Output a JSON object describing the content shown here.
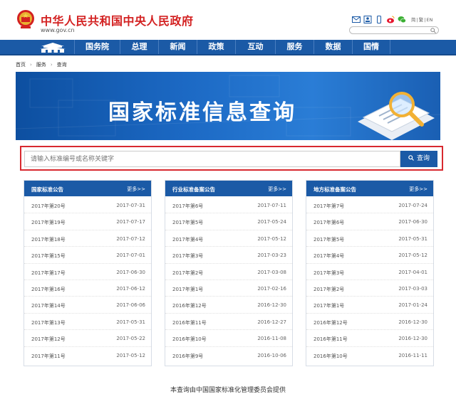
{
  "header": {
    "title": "中华人民共和国中央人民政府",
    "url": "www.gov.cn",
    "lang": [
      "简",
      "繁",
      "EN"
    ]
  },
  "nav": {
    "items": [
      "国务院",
      "总理",
      "新闻",
      "政策",
      "互动",
      "服务",
      "数据",
      "国情"
    ]
  },
  "breadcrumb": [
    "首页",
    "服务",
    "查询"
  ],
  "banner": {
    "title": "国家标准信息查询"
  },
  "search": {
    "placeholder": "请输入标准编号或名称关键字",
    "button": "查询"
  },
  "panels": [
    {
      "title": "国家标准公告",
      "more": "更多>>",
      "rows": [
        [
          "2017年第20号",
          "2017-07-31"
        ],
        [
          "2017年第19号",
          "2017-07-17"
        ],
        [
          "2017年第18号",
          "2017-07-12"
        ],
        [
          "2017年第15号",
          "2017-07-01"
        ],
        [
          "2017年第17号",
          "2017-06-30"
        ],
        [
          "2017年第16号",
          "2017-06-12"
        ],
        [
          "2017年第14号",
          "2017-06-06"
        ],
        [
          "2017年第13号",
          "2017-05-31"
        ],
        [
          "2017年第12号",
          "2017-05-22"
        ],
        [
          "2017年第11号",
          "2017-05-12"
        ]
      ]
    },
    {
      "title": "行业标准备案公告",
      "more": "更多>>",
      "rows": [
        [
          "2017年第6号",
          "2017-07-11"
        ],
        [
          "2017年第5号",
          "2017-05-24"
        ],
        [
          "2017年第4号",
          "2017-05-12"
        ],
        [
          "2017年第3号",
          "2017-03-23"
        ],
        [
          "2017年第2号",
          "2017-03-08"
        ],
        [
          "2017年第1号",
          "2017-02-16"
        ],
        [
          "2016年第12号",
          "2016-12-30"
        ],
        [
          "2016年第11号",
          "2016-12-27"
        ],
        [
          "2016年第10号",
          "2016-11-08"
        ],
        [
          "2016年第9号",
          "2016-10-06"
        ]
      ]
    },
    {
      "title": "地方标准备案公告",
      "more": "更多>>",
      "rows": [
        [
          "2017年第7号",
          "2017-07-24"
        ],
        [
          "2017年第6号",
          "2017-06-30"
        ],
        [
          "2017年第5号",
          "2017-05-31"
        ],
        [
          "2017年第4号",
          "2017-05-12"
        ],
        [
          "2017年第3号",
          "2017-04-01"
        ],
        [
          "2017年第2号",
          "2017-03-03"
        ],
        [
          "2017年第1号",
          "2017-01-24"
        ],
        [
          "2016年第12号",
          "2016-12-30"
        ],
        [
          "2016年第11号",
          "2016-12-30"
        ],
        [
          "2016年第10号",
          "2016-11-11"
        ]
      ]
    }
  ],
  "footer": {
    "note": "本查询由中国国家标准化管理委员会提供"
  },
  "colors": {
    "primary": "#1b5aa6",
    "brand_red": "#d32121",
    "highlight_border": "#d8292f"
  },
  "icons": [
    "national-emblem-icon",
    "mail-icon",
    "contacts-icon",
    "mobile-icon",
    "weibo-icon",
    "wechat-icon",
    "search-icon",
    "tiananmen-icon"
  ]
}
